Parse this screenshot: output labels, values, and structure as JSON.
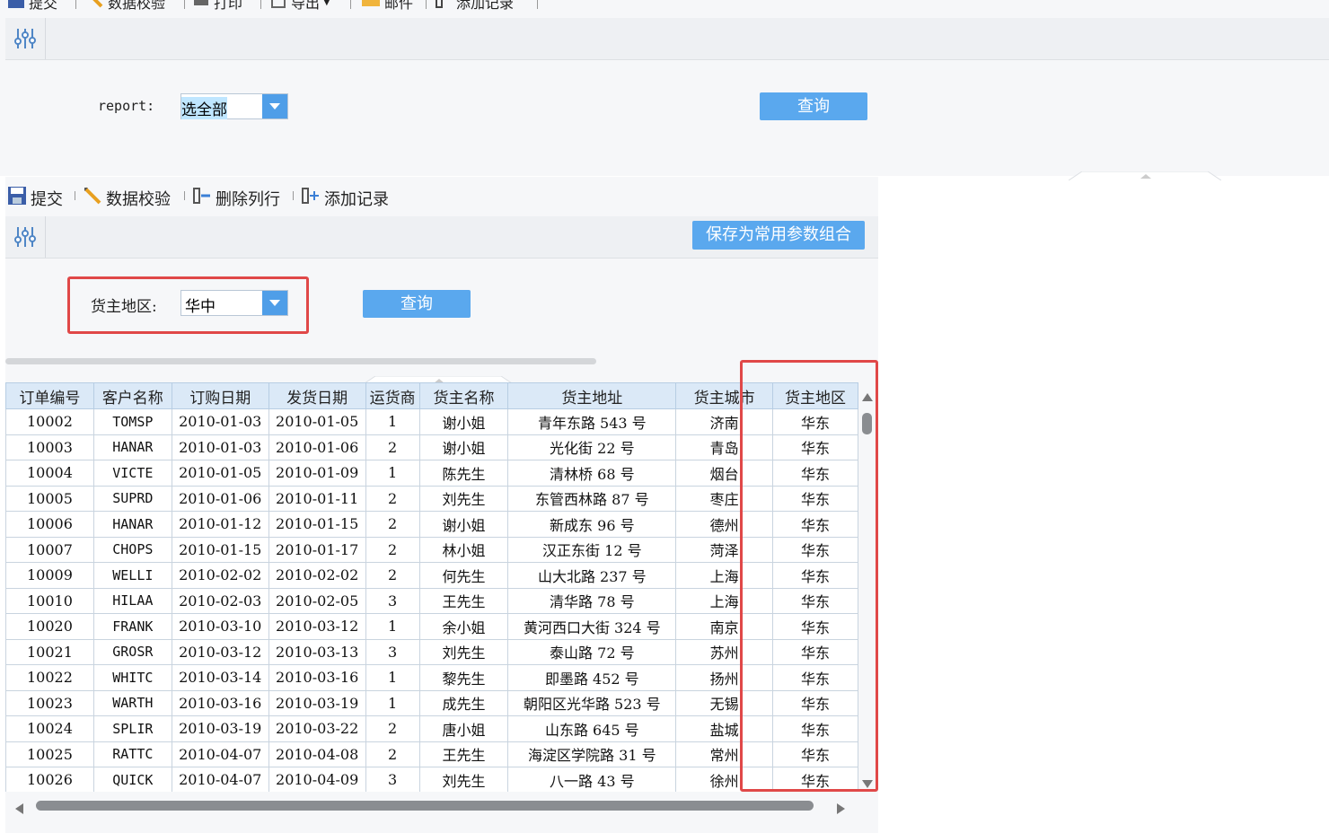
{
  "top_toolbar": {
    "submit": "提交",
    "validate": "数据校验",
    "print": "打印",
    "export": "导出",
    "mail": "邮件",
    "add_record": "添加记录"
  },
  "top_params": {
    "report_label": "report:",
    "report_value": "选全部",
    "query_label": "查询"
  },
  "form_toolbar": {
    "submit": "提交",
    "validate": "数据校验",
    "delete_row": "删除列行",
    "add_record": "添加记录",
    "save_params": "保存为常用参数组合"
  },
  "form_params": {
    "region_label": "货主地区:",
    "region_value": "华中",
    "query_label": "查询"
  },
  "table": {
    "columns": [
      "订单编号",
      "客户名称",
      "订购日期",
      "发货日期",
      "运货商",
      "货主名称",
      "货主地址",
      "货主城市",
      "货主地区"
    ],
    "rows": [
      [
        "10002",
        "TOMSP",
        "2010-01-03",
        "2010-01-05",
        "1",
        "谢小姐",
        "青年东路 543 号",
        "济南",
        "华东"
      ],
      [
        "10003",
        "HANAR",
        "2010-01-03",
        "2010-01-06",
        "2",
        "谢小姐",
        "光化街 22 号",
        "青岛",
        "华东"
      ],
      [
        "10004",
        "VICTE",
        "2010-01-05",
        "2010-01-09",
        "1",
        "陈先生",
        "清林桥 68 号",
        "烟台",
        "华东"
      ],
      [
        "10005",
        "SUPRD",
        "2010-01-06",
        "2010-01-11",
        "2",
        "刘先生",
        "东管西林路 87 号",
        "枣庄",
        "华东"
      ],
      [
        "10006",
        "HANAR",
        "2010-01-12",
        "2010-01-15",
        "2",
        "谢小姐",
        "新成东 96 号",
        "德州",
        "华东"
      ],
      [
        "10007",
        "CHOPS",
        "2010-01-15",
        "2010-01-17",
        "2",
        "林小姐",
        "汉正东街 12 号",
        "菏泽",
        "华东"
      ],
      [
        "10009",
        "WELLI",
        "2010-02-02",
        "2010-02-02",
        "2",
        "何先生",
        "山大北路 237 号",
        "上海",
        "华东"
      ],
      [
        "10010",
        "HILAA",
        "2010-02-03",
        "2010-02-05",
        "3",
        "王先生",
        "清华路 78 号",
        "上海",
        "华东"
      ],
      [
        "10020",
        "FRANK",
        "2010-03-10",
        "2010-03-12",
        "1",
        "余小姐",
        "黄河西口大街 324 号",
        "南京",
        "华东"
      ],
      [
        "10021",
        "GROSR",
        "2010-03-12",
        "2010-03-13",
        "3",
        "刘先生",
        "泰山路 72 号",
        "苏州",
        "华东"
      ],
      [
        "10022",
        "WHITC",
        "2010-03-14",
        "2010-03-16",
        "1",
        "黎先生",
        "即墨路 452 号",
        "扬州",
        "华东"
      ],
      [
        "10023",
        "WARTH",
        "2010-03-16",
        "2010-03-19",
        "1",
        "成先生",
        "朝阳区光华路 523 号",
        "无锡",
        "华东"
      ],
      [
        "10024",
        "SPLIR",
        "2010-03-19",
        "2010-03-22",
        "2",
        "唐小姐",
        "山东路 645 号",
        "盐城",
        "华东"
      ],
      [
        "10025",
        "RATTC",
        "2010-04-07",
        "2010-04-08",
        "2",
        "王先生",
        "海淀区学院路 31 号",
        "常州",
        "华东"
      ],
      [
        "10026",
        "QUICK",
        "2010-04-07",
        "2010-04-09",
        "3",
        "刘先生",
        "八一路 43 号",
        "徐州",
        "华东"
      ]
    ]
  },
  "colors": {
    "accent_blue": "#5aa8ee",
    "highlight_red": "#e04848",
    "header_bg": "#dbe9f7"
  }
}
